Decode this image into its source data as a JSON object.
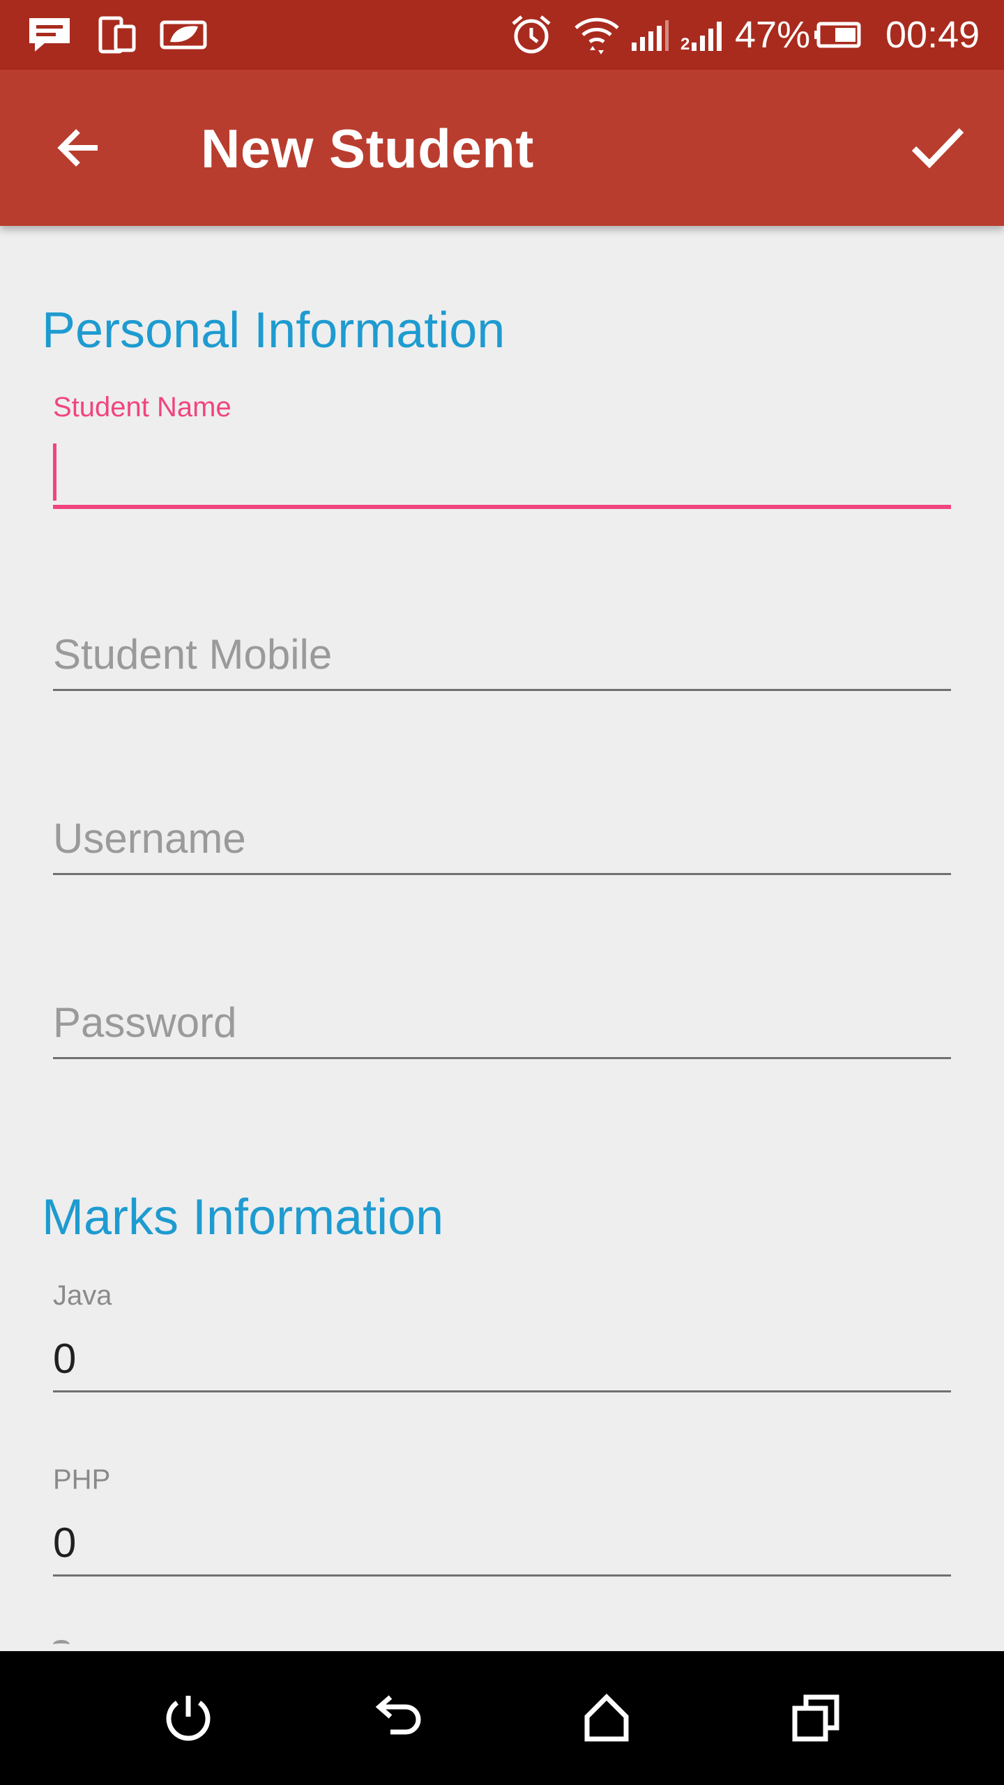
{
  "status_bar": {
    "icons": [
      "message-icon",
      "device-sync-icon",
      "leaf-battery-saver-icon",
      "alarm-icon",
      "wifi-icon",
      "signal-1-icon",
      "signal-2-icon",
      "battery-icon"
    ],
    "battery_percent": "47%",
    "time": "00:49"
  },
  "app_bar": {
    "title": "New Student",
    "back_icon": "arrow-back-icon",
    "done_icon": "checkmark-icon",
    "color": "#b93d2e"
  },
  "sections": {
    "personal": {
      "title": "Personal Information",
      "student_name": {
        "label": "Student Name",
        "value": ""
      },
      "student_mobile": {
        "placeholder": "Student Mobile"
      },
      "username": {
        "placeholder": "Username"
      },
      "password": {
        "placeholder": "Password"
      }
    },
    "marks": {
      "title": "Marks Information",
      "java": {
        "label": "Java",
        "value": "0"
      },
      "php": {
        "label": "PHP",
        "value": "0"
      }
    }
  },
  "colors": {
    "status_bar": "#a92b1e",
    "accent": "#f0457e",
    "section_title": "#1e9bd0"
  },
  "nav_bar": {
    "icons": [
      "power-icon",
      "back-icon",
      "home-icon",
      "recents-icon"
    ]
  }
}
